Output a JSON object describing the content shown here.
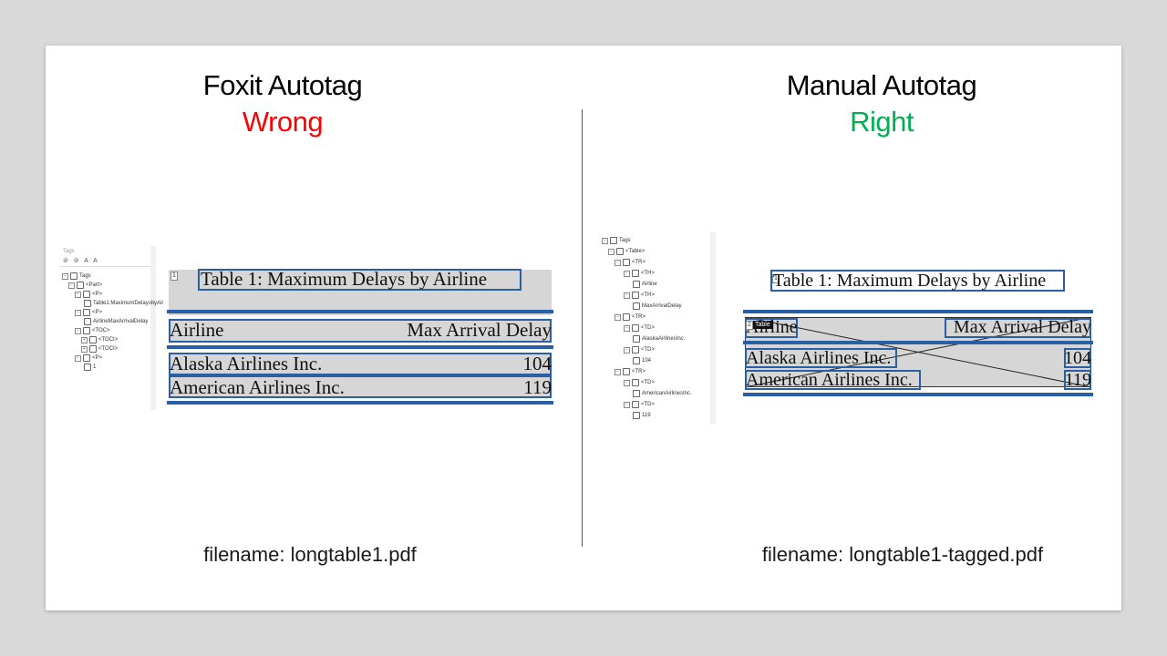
{
  "left": {
    "heading": "Foxit Autotag",
    "verdict": "Wrong",
    "verdict_color": "#ff0000",
    "filename": "filename: longtable1.pdf",
    "panel": {
      "title": "Tags",
      "tree": [
        "Tags",
        "<Part>",
        "<P>",
        "Table1:MaximumDelaysbyAir",
        "<P>",
        "AirlineMaxArrivalDelay",
        "<TOC>",
        "<TOCI>",
        "<TOCI>",
        "<P>",
        "1"
      ]
    },
    "pdf": {
      "caption": "Table 1: Maximum Delays by Airline",
      "badge": "1",
      "header": [
        "Airline",
        "Max Arrival Delay"
      ],
      "rows": [
        [
          "Alaska Airlines Inc.",
          "104"
        ],
        [
          "American Airlines Inc.",
          "119"
        ]
      ]
    }
  },
  "right": {
    "heading": "Manual Autotag",
    "verdict": "Right",
    "verdict_color": "#00b050",
    "filename": "filename: longtable1-tagged.pdf",
    "panel": {
      "tree": [
        "Tags",
        "<Table>",
        "<TR>",
        "<TH>",
        "Airline",
        "<TH>",
        "MaxArrivalDelay",
        "<TR>",
        "<TD>",
        "AlaskaAirlinesInc.",
        "<TD>",
        "104",
        "<TR>",
        "<TD>",
        "AmericanAirlinesInc.",
        "<TD>",
        "119"
      ]
    },
    "pdf": {
      "caption": "Table 1: Maximum Delays by Airline",
      "badge": "1",
      "table_badge_num": "2",
      "table_badge": "Table",
      "header": [
        "Airline",
        "Max Arrival Delay"
      ],
      "rows": [
        [
          "Alaska Airlines Inc.",
          "104"
        ],
        [
          "American Airlines Inc.",
          "119"
        ]
      ]
    }
  }
}
